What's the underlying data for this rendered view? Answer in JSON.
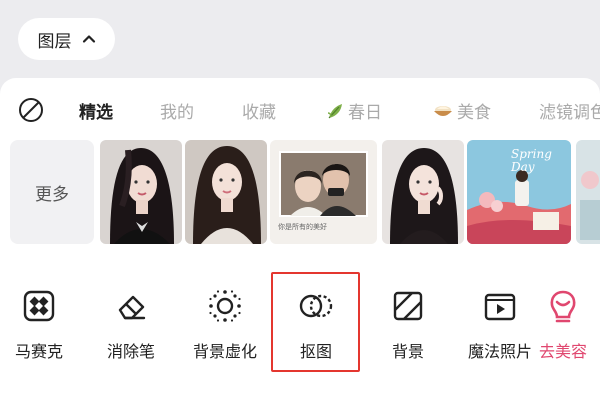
{
  "layer_button": {
    "label": "图层"
  },
  "tabs": [
    {
      "label": "精选",
      "active": true
    },
    {
      "label": "我的",
      "active": false
    },
    {
      "label": "收藏",
      "active": false
    },
    {
      "label": "春日",
      "icon": "leaf-icon",
      "active": false
    },
    {
      "label": "美食",
      "icon": "food-bowl-icon",
      "active": false
    },
    {
      "label": "滤镜调色",
      "active": false
    }
  ],
  "filters": {
    "more_label": "更多",
    "thumbnails": [
      {
        "name": "portrait-1"
      },
      {
        "name": "portrait-2"
      },
      {
        "name": "portrait-3"
      },
      {
        "name": "couple-photo",
        "caption": "你是所有的美好"
      },
      {
        "name": "portrait-4"
      },
      {
        "name": "spring-day",
        "title": "Spring Day"
      },
      {
        "name": "partial"
      }
    ]
  },
  "tools": [
    {
      "label": "马赛克",
      "icon": "mosaic-icon"
    },
    {
      "label": "消除笔",
      "icon": "eraser-icon"
    },
    {
      "label": "背景虚化",
      "icon": "blur-background-icon"
    },
    {
      "label": "抠图",
      "icon": "cutout-icon",
      "highlighted": true
    },
    {
      "label": "背景",
      "icon": "background-icon"
    },
    {
      "label": "魔法照片",
      "icon": "magic-photo-icon"
    },
    {
      "label": "去美容",
      "icon": "beauty-icon",
      "accent": "#e0476f"
    }
  ],
  "colors": {
    "highlight_border": "#e4362f",
    "accent_pink": "#e0476f"
  }
}
